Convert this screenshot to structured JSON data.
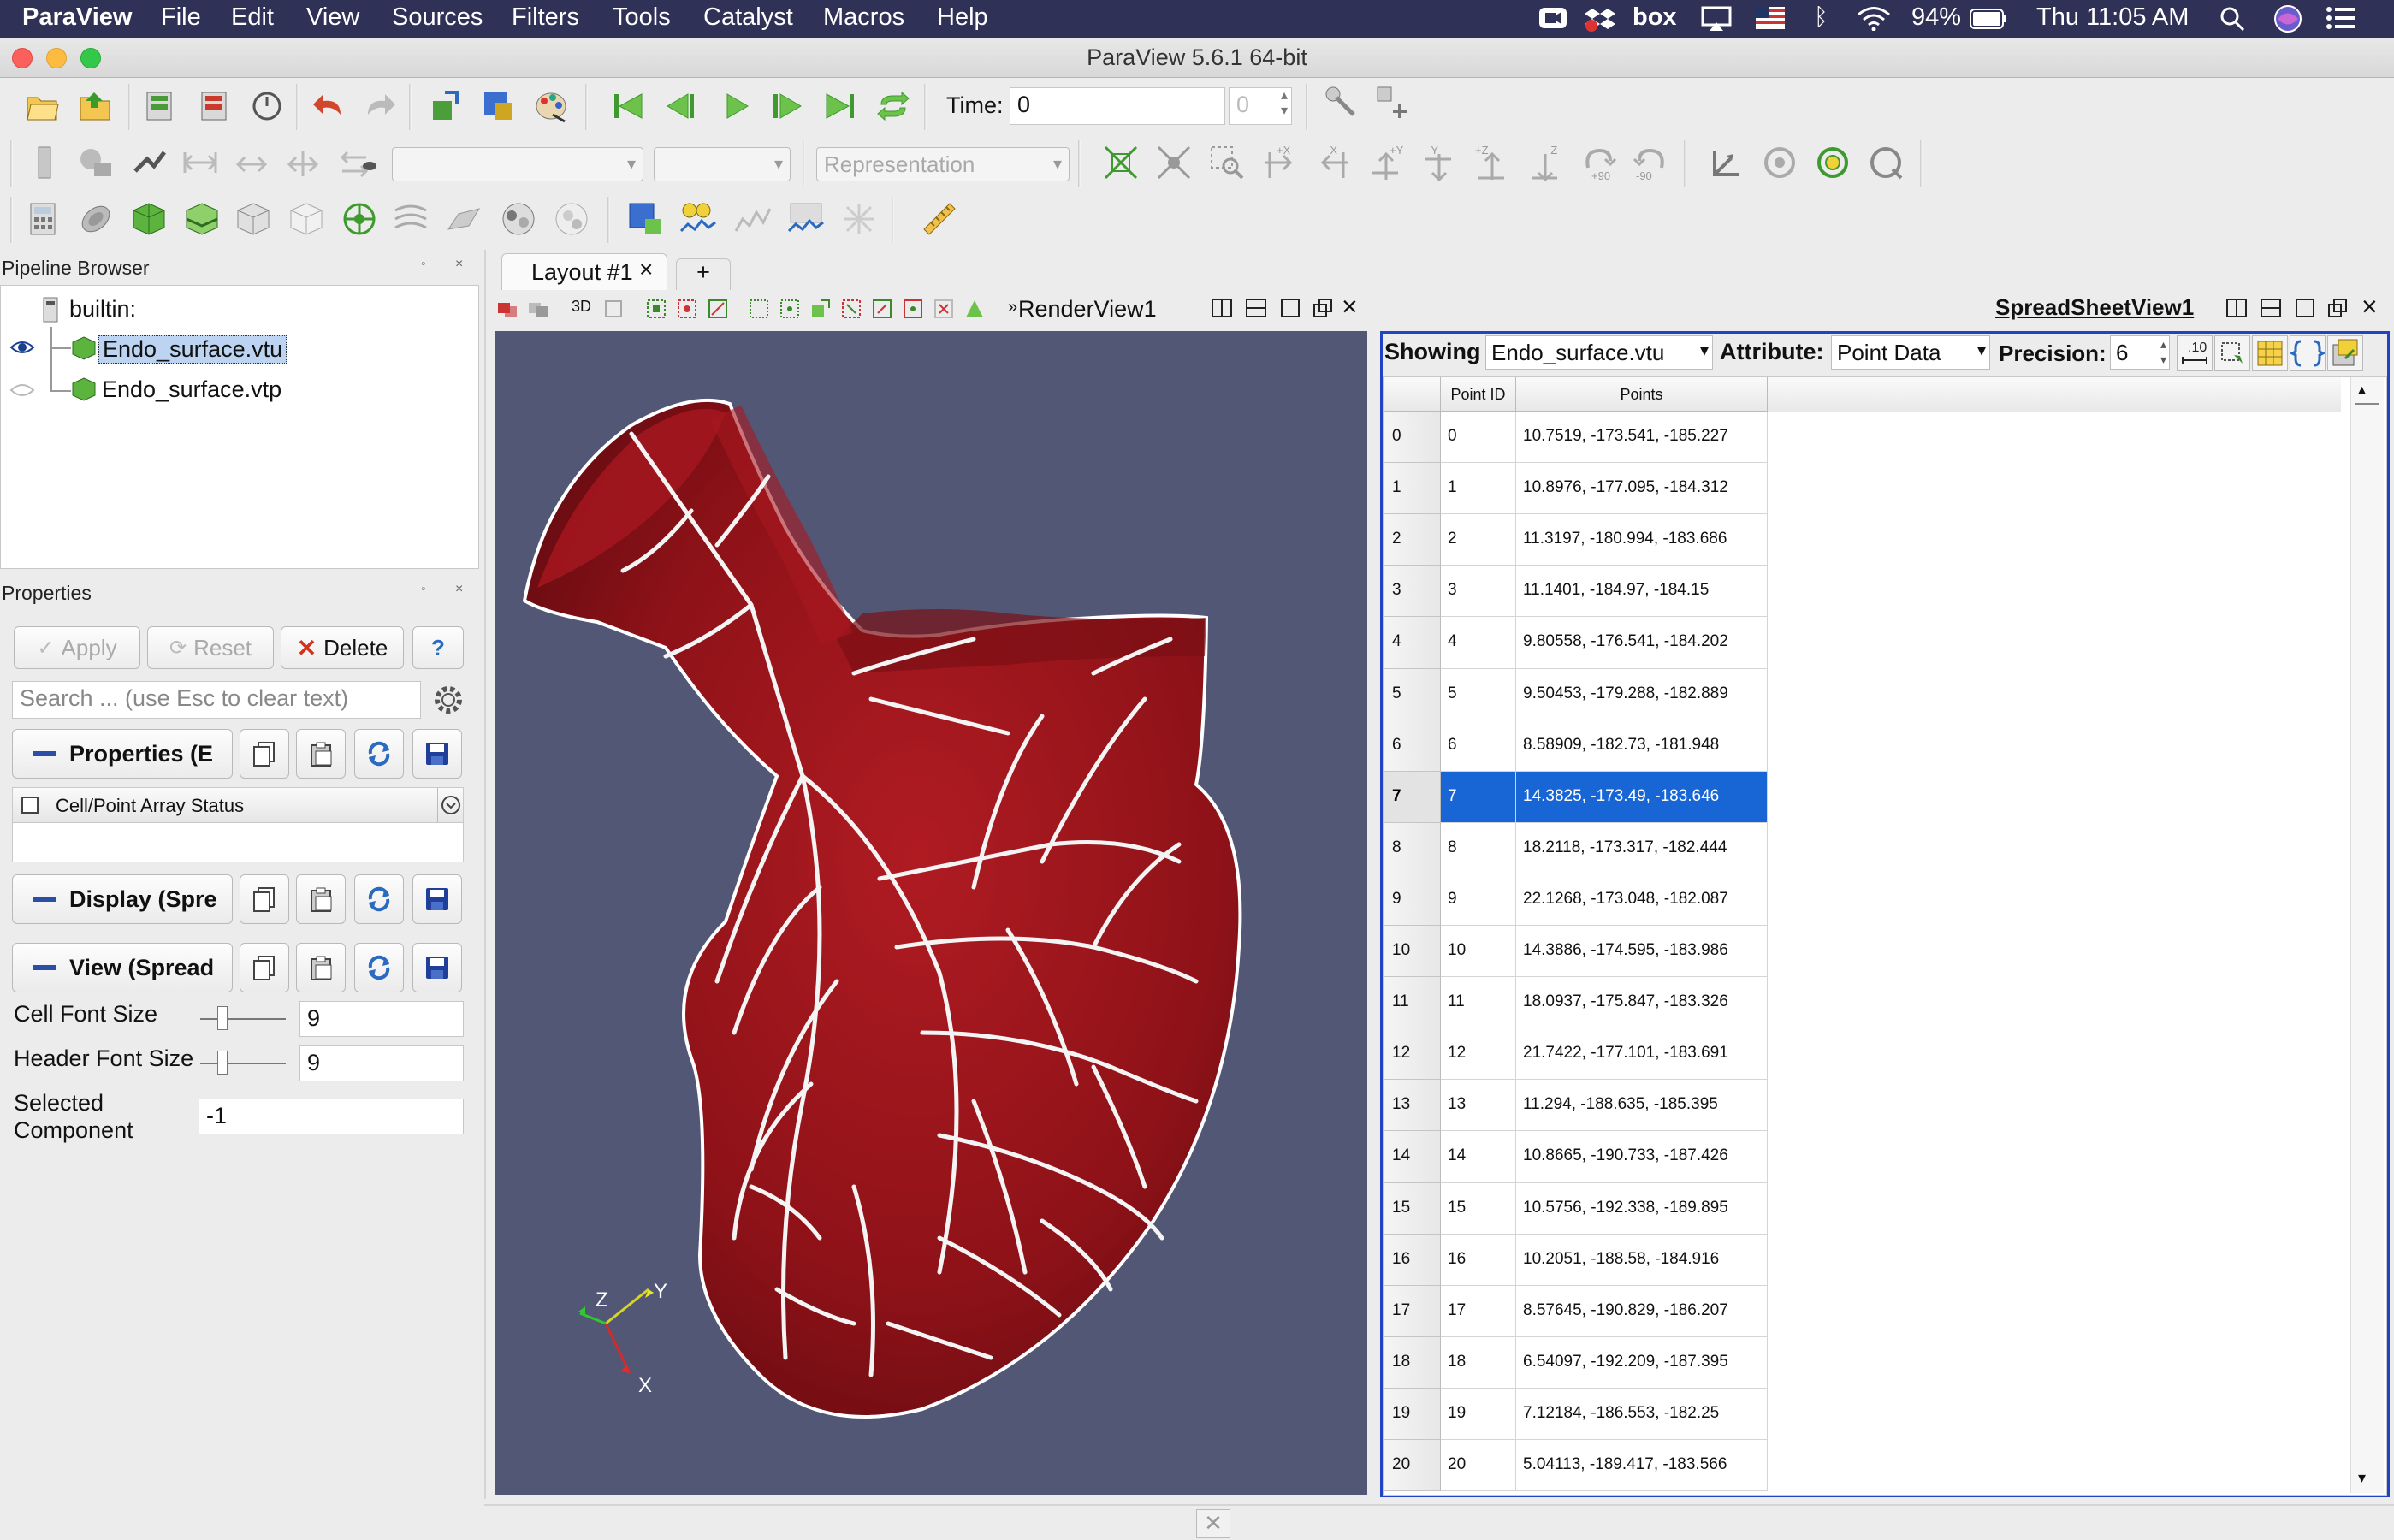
{
  "menubar": {
    "app": "ParaView",
    "items": [
      "File",
      "Edit",
      "View",
      "Sources",
      "Filters",
      "Tools",
      "Catalyst",
      "Macros",
      "Help"
    ],
    "battery": "94%",
    "clock": "Thu 11:05 AM",
    "box": "box"
  },
  "window": {
    "title": "ParaView 5.6.1 64-bit"
  },
  "toolbar": {
    "time_label": "Time:",
    "time_value": "0",
    "time_index": "0",
    "representation_placeholder": "Representation",
    "camera_rot_plus": "+90",
    "camera_rot_minus": "-90"
  },
  "pipeline": {
    "title": "Pipeline Browser",
    "root": "builtin:",
    "items": [
      "Endo_surface.vtu",
      "Endo_surface.vtp"
    ]
  },
  "properties": {
    "title": "Properties",
    "apply": "Apply",
    "reset": "Reset",
    "delete": "Delete",
    "help": "?",
    "search_placeholder": "Search ... (use Esc to clear text)",
    "section_properties": "Properties (E",
    "array_status": "Cell/Point Array Status",
    "section_display": "Display (Spre",
    "section_view": "View (Spread",
    "cell_font_label": "Cell Font Size",
    "cell_font_value": "9",
    "header_font_label": "Header Font Size",
    "header_font_value": "9",
    "selected_component_label1": "Selected",
    "selected_component_label2": "Component",
    "selected_component_value": "-1"
  },
  "layout": {
    "tab": "Layout #1",
    "add": "+",
    "render_view": "RenderView1",
    "mode3d": "3D",
    "axes": {
      "x": "X",
      "y": "Y",
      "z": "Z"
    }
  },
  "spreadsheet": {
    "title": "SpreadSheetView1",
    "showing_label": "Showing",
    "showing_value": "Endo_surface.vtu",
    "attribute_label": "Attribute:",
    "attribute_value": "Point Data",
    "precision_label": "Precision:",
    "precision_value": "6",
    "columns": [
      "Point ID",
      "Points"
    ],
    "selected_row": 7,
    "rows": [
      {
        "id": "0",
        "pts": "10.7519, -173.541, -185.227"
      },
      {
        "id": "1",
        "pts": "10.8976, -177.095, -184.312"
      },
      {
        "id": "2",
        "pts": "11.3197, -180.994, -183.686"
      },
      {
        "id": "3",
        "pts": "11.1401, -184.97, -184.15"
      },
      {
        "id": "4",
        "pts": "9.80558, -176.541, -184.202"
      },
      {
        "id": "5",
        "pts": "9.50453, -179.288, -182.889"
      },
      {
        "id": "6",
        "pts": "8.58909, -182.73, -181.948"
      },
      {
        "id": "7",
        "pts": "14.3825, -173.49, -183.646"
      },
      {
        "id": "8",
        "pts": "18.2118, -173.317, -182.444"
      },
      {
        "id": "9",
        "pts": "22.1268, -173.048, -182.087"
      },
      {
        "id": "10",
        "pts": "14.3886, -174.595, -183.986"
      },
      {
        "id": "11",
        "pts": "18.0937, -175.847, -183.326"
      },
      {
        "id": "12",
        "pts": "21.7422, -177.101, -183.691"
      },
      {
        "id": "13",
        "pts": "11.294, -188.635, -185.395"
      },
      {
        "id": "14",
        "pts": "10.8665, -190.733, -187.426"
      },
      {
        "id": "15",
        "pts": "10.5756, -192.338, -189.895"
      },
      {
        "id": "16",
        "pts": "10.2051, -188.58, -184.916"
      },
      {
        "id": "17",
        "pts": "8.57645, -190.829, -186.207"
      },
      {
        "id": "18",
        "pts": "6.54097, -192.209, -187.395"
      },
      {
        "id": "19",
        "pts": "7.12184, -186.553, -182.25"
      },
      {
        "id": "20",
        "pts": "5.04113, -189.417, -183.566"
      }
    ]
  },
  "colors": {
    "menubar": "#2f3157",
    "render_bg": "#525776",
    "selection": "#1866d6",
    "active_view_border": "#2143c5"
  }
}
